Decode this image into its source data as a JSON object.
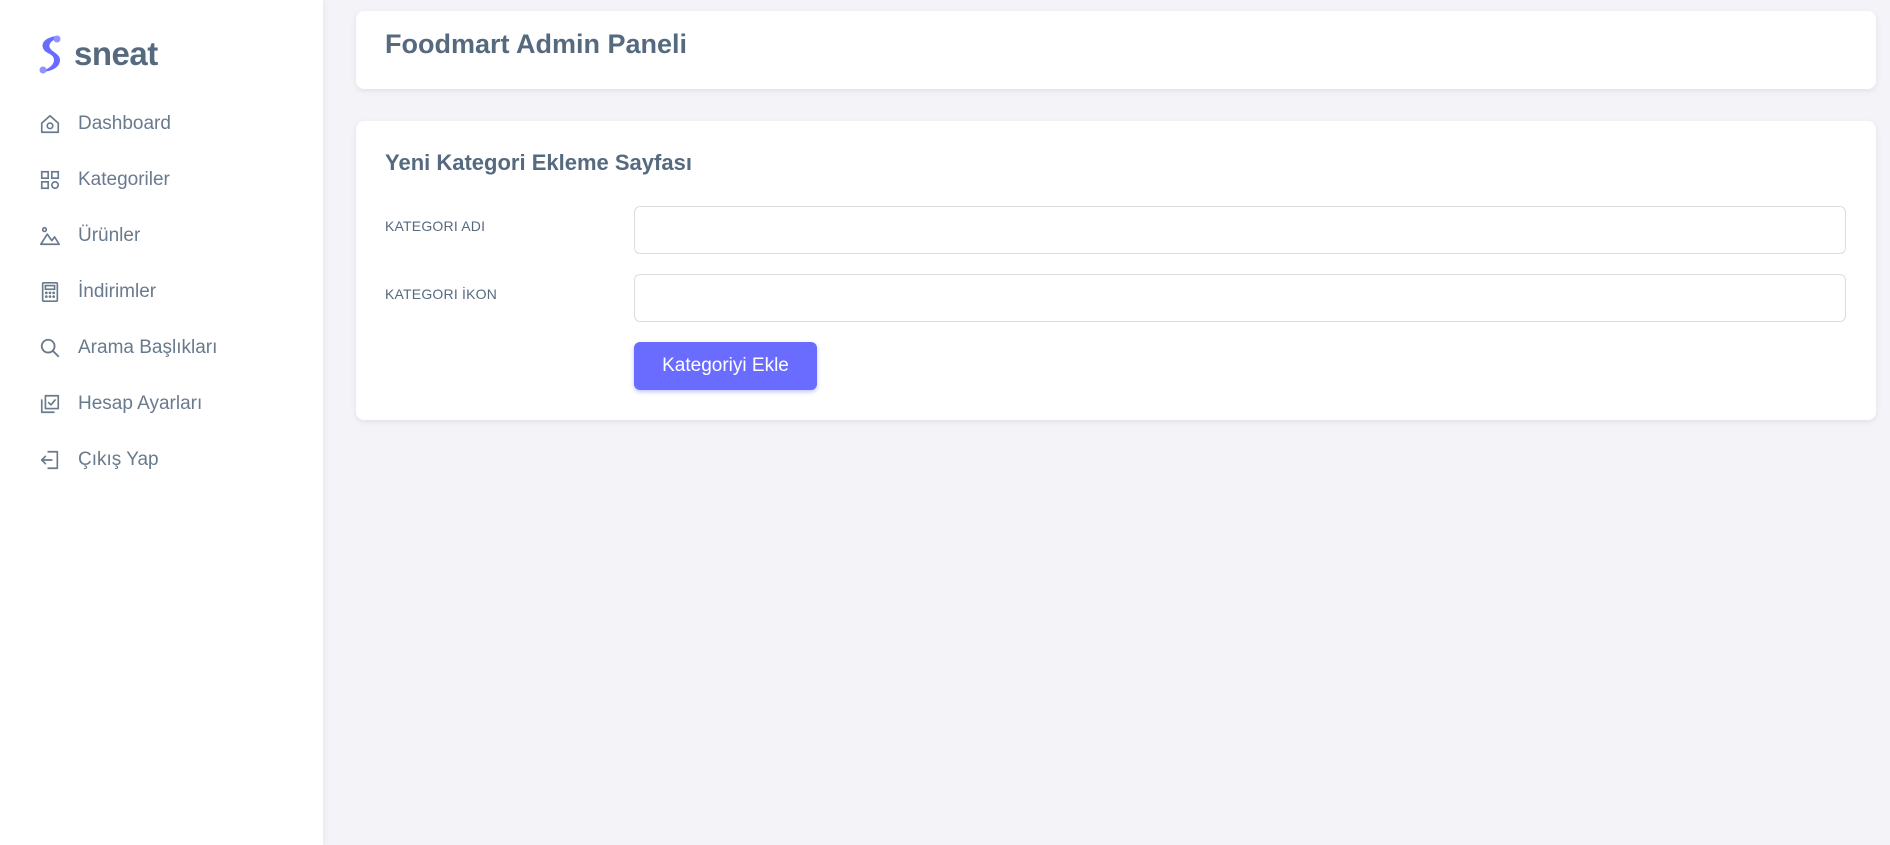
{
  "brand": {
    "name": "sneat",
    "accent_color": "#696cff"
  },
  "sidebar": {
    "items": [
      {
        "label": "Dashboard",
        "icon": "home-icon"
      },
      {
        "label": "Kategoriler",
        "icon": "grid-icon"
      },
      {
        "label": "Ürünler",
        "icon": "landscape-icon"
      },
      {
        "label": "İndirimler",
        "icon": "calculator-icon"
      },
      {
        "label": "Arama Başlıkları",
        "icon": "search-icon"
      },
      {
        "label": "Hesap Ayarları",
        "icon": "checklist-icon"
      },
      {
        "label": "Çıkış Yap",
        "icon": "logout-icon"
      }
    ]
  },
  "header": {
    "title": "Foodmart Admin Paneli"
  },
  "form": {
    "title": "Yeni Kategori Ekleme Sayfası",
    "fields": [
      {
        "label": "KATEGORI ADI",
        "value": "",
        "placeholder": ""
      },
      {
        "label": "KATEGORI İKON",
        "value": "",
        "placeholder": ""
      }
    ],
    "submit_label": "Kategoriyi Ekle"
  }
}
